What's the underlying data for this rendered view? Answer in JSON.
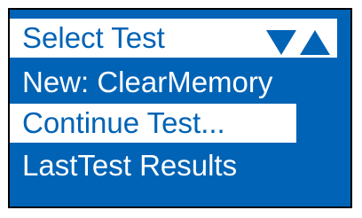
{
  "screen": {
    "header": {
      "title": "Select Test",
      "scroll_down_icon": "triangle-down",
      "scroll_up_icon": "triangle-up"
    },
    "menu": {
      "items": [
        {
          "label": "New: ClearMemory",
          "selected": false
        },
        {
          "label": "Continue Test...",
          "selected": true
        },
        {
          "label": "LastTest Results",
          "selected": false
        }
      ]
    },
    "colors": {
      "background": "#0063b5",
      "highlight": "#ffffff",
      "border": "#000000"
    }
  }
}
